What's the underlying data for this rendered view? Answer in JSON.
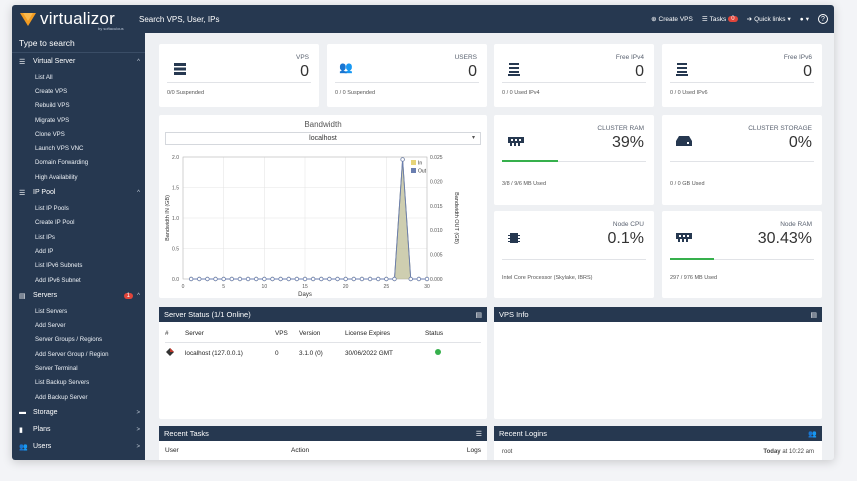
{
  "topbar": {
    "logo": "virtualizor",
    "logo_sub": "by softaculous",
    "search_placeholder": "Search VPS, User, IPs",
    "create_vps": "Create VPS",
    "tasks": "Tasks",
    "tasks_count": "0",
    "quick_links": "Quick links"
  },
  "sidebar": {
    "search": "Type to search",
    "virtual_server": {
      "label": "Virtual Server",
      "items": [
        "List All",
        "Create VPS",
        "Rebuild VPS",
        "Migrate VPS",
        "Clone VPS",
        "Launch VPS VNC",
        "Domain Forwarding",
        "High Availability"
      ]
    },
    "ip_pool": {
      "label": "IP Pool",
      "items": [
        "List IP Pools",
        "Create IP Pool",
        "List IPs",
        "Add IP",
        "List IPv6 Subnets",
        "Add IPv6 Subnet"
      ]
    },
    "servers": {
      "label": "Servers",
      "badge": "1",
      "items": [
        "List Servers",
        "Add Server",
        "Server Groups / Regions",
        "Add Server Group / Region",
        "Server Terminal",
        "List Backup Servers",
        "Add Backup Server"
      ]
    },
    "storage": "Storage",
    "plans": "Plans",
    "users": "Users"
  },
  "stats": {
    "vps": {
      "label": "VPS",
      "value": "0",
      "sub": "0/0 Suspended"
    },
    "users": {
      "label": "USERS",
      "value": "0",
      "sub": "0 / 0 Suspended"
    },
    "ipv4": {
      "label": "Free IPv4",
      "value": "0",
      "sub": "0 / 0 Used IPv4"
    },
    "ipv6": {
      "label": "Free IPv6",
      "value": "0",
      "sub": "0 / 0 Used IPv6"
    },
    "ram": {
      "label": "CLUSTER RAM",
      "value": "39%",
      "sub": "3/8 / 9/6 MB Used",
      "fill": 0.39
    },
    "storage": {
      "label": "CLUSTER STORAGE",
      "value": "0%",
      "sub": "0 / 0 GB Used",
      "fill": 0
    },
    "cpu": {
      "label": "Node CPU",
      "value": "0.1%",
      "sub": "Intel Core Processor (Skylake, IBRS)",
      "fill": 0.001
    },
    "noderam": {
      "label": "Node RAM",
      "value": "30.43%",
      "sub": "297 / 976 MB Used",
      "fill": 0.3043
    }
  },
  "bandwidth": {
    "title": "Bandwidth",
    "server": "localhost"
  },
  "chart_data": {
    "type": "line",
    "title": "Bandwidth",
    "xlabel": "Days",
    "ylabel": "Bandwidth IN (GB)",
    "ylabel_right": "Bandwidth OUT (GB)",
    "x": [
      1,
      2,
      3,
      4,
      5,
      6,
      7,
      8,
      9,
      10,
      11,
      12,
      13,
      14,
      15,
      16,
      17,
      18,
      19,
      20,
      21,
      22,
      23,
      24,
      25,
      26,
      27,
      28,
      29,
      30
    ],
    "xticks": [
      "0",
      "5",
      "10",
      "15",
      "20",
      "25",
      "30"
    ],
    "yticks_left": [
      "0.0",
      "0.5",
      "1.0",
      "1.5",
      "2.0"
    ],
    "yticks_right": [
      "0.000",
      "0.005",
      "0.010",
      "0.015",
      "0.020",
      "0.025"
    ],
    "ylim_left": [
      0,
      2
    ],
    "ylim_right": [
      0,
      0.025
    ],
    "series": [
      {
        "name": "In",
        "color": "#e6d47a",
        "values": [
          0,
          0,
          0,
          0,
          0,
          0,
          0,
          0,
          0,
          0,
          0,
          0,
          0,
          0,
          0,
          0,
          0,
          0,
          0,
          0,
          0,
          0,
          0,
          0,
          0,
          0,
          0.0245,
          0,
          0,
          0
        ]
      },
      {
        "name": "Out",
        "color": "#6a7eb0",
        "values": [
          0,
          0,
          0,
          0,
          0,
          0,
          0,
          0,
          0,
          0,
          0,
          0,
          0,
          0,
          0,
          0,
          0,
          0,
          0,
          0,
          0,
          0,
          0,
          0,
          0,
          0,
          0.0245,
          0,
          0,
          0
        ]
      }
    ],
    "legend": "top-right",
    "grid": true
  },
  "server_status": {
    "title": "Server Status (1/1 Online)",
    "headers": [
      "#",
      "Server",
      "VPS",
      "Version",
      "License Expires",
      "Status"
    ],
    "rows": [
      {
        "server": "localhost (127.0.0.1)",
        "vps": "0",
        "version": "3.1.0 (0)",
        "license": "30/06/2022 GMT",
        "status": "online"
      }
    ]
  },
  "vps_info": {
    "title": "VPS Info"
  },
  "recent_tasks": {
    "title": "Recent Tasks",
    "headers": [
      "User",
      "Action",
      "Logs"
    ]
  },
  "recent_logins": {
    "title": "Recent Logins",
    "rows": [
      {
        "user": "root",
        "when": "Today",
        "time": "at 10:22 am"
      }
    ]
  },
  "colors": {
    "nav": "#263850",
    "accent": "#f39c22",
    "ok": "#36b04c",
    "badge": "#e0453b"
  }
}
